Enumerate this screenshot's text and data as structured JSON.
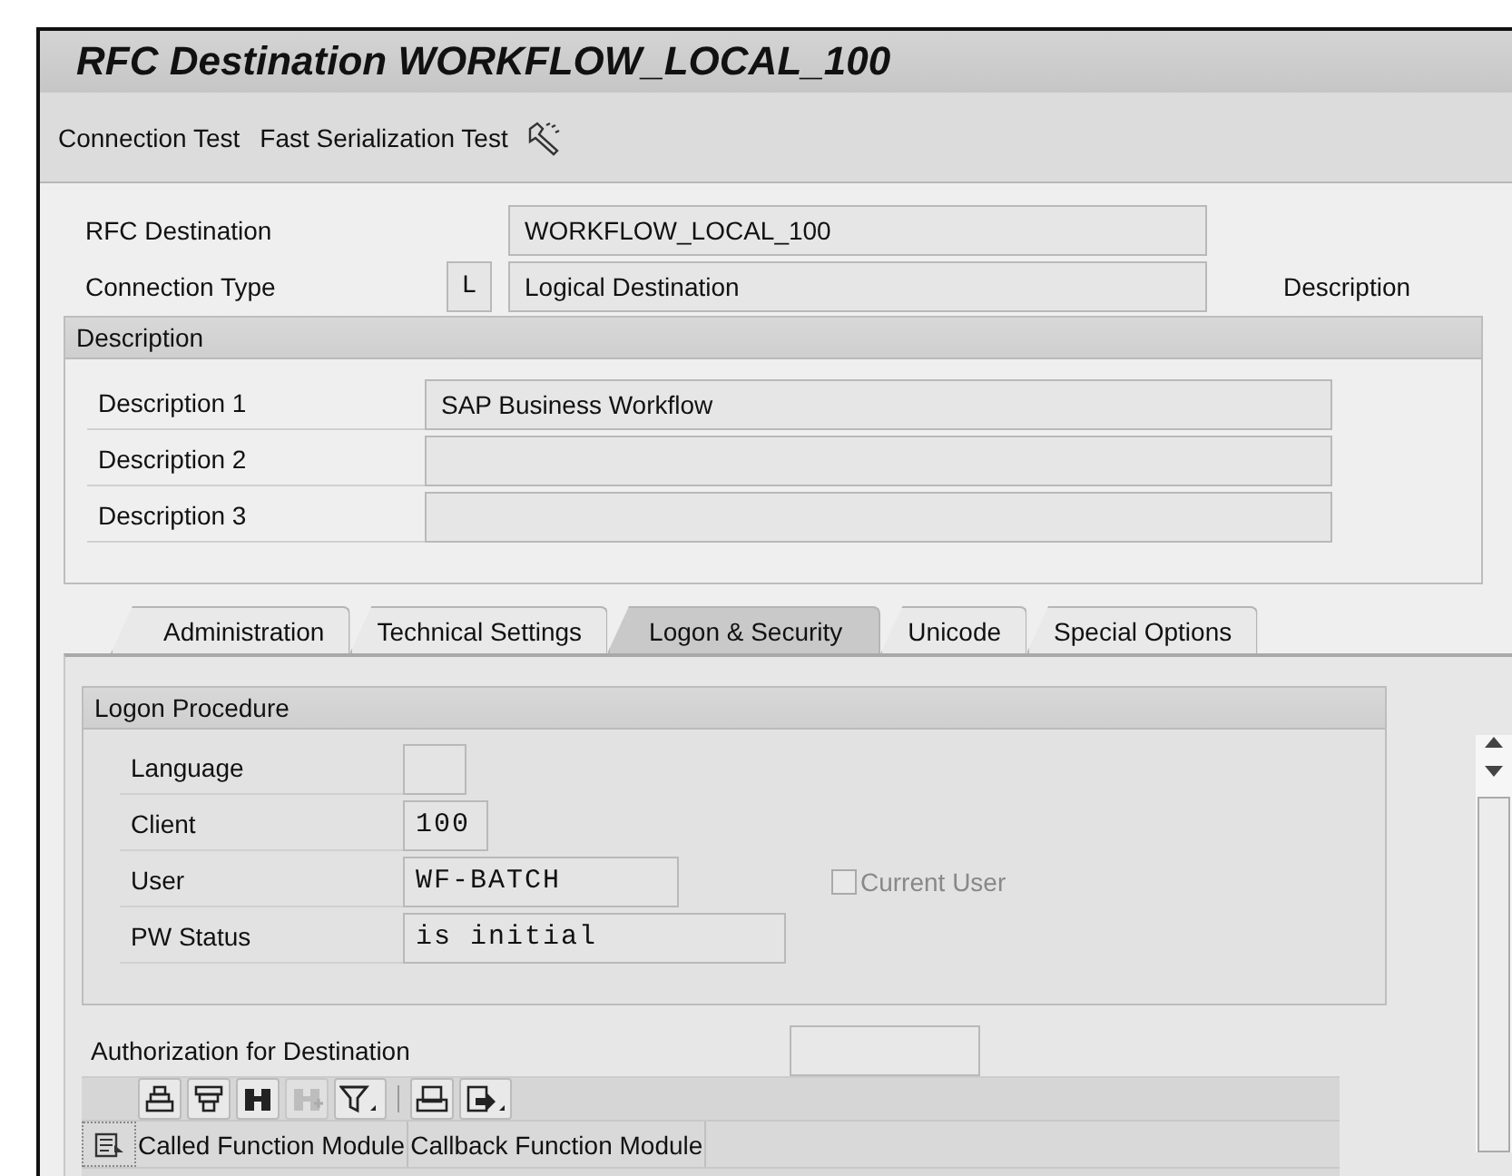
{
  "window": {
    "title": "RFC Destination WORKFLOW_LOCAL_100"
  },
  "toolbar": [
    {
      "kind": "text",
      "label": "Connection Test"
    },
    {
      "kind": "text",
      "label": "Fast Serialization Test"
    },
    {
      "kind": "icon"
    }
  ],
  "header_fields": [
    {
      "label": "RFC Destination",
      "value": "WORKFLOW_LOCAL_100"
    },
    {
      "label": "Connection Type",
      "code": "L",
      "value": "Logical Destination",
      "note": "Description"
    }
  ],
  "description_group": {
    "title": "Description",
    "rows": [
      {
        "label": "Description 1",
        "value": "SAP Business Workflow"
      },
      {
        "label": "Description 2"
      },
      {
        "label": "Description 3"
      }
    ]
  },
  "tabs": [
    {
      "label": "Administration",
      "selected": false
    },
    {
      "label": "Technical Settings",
      "selected": false
    },
    {
      "label": "Logon & Security",
      "selected": true
    },
    {
      "label": "Unicode",
      "selected": false
    },
    {
      "label": "Special Options",
      "selected": false
    }
  ],
  "logon_group": {
    "title": "Logon Procedure",
    "rows": [
      {
        "label": "Language"
      },
      {
        "label": "Client",
        "value": "100"
      },
      {
        "label": "User",
        "value": "WF-BATCH",
        "checkbox": {
          "label": "Current User",
          "checked": false,
          "disabled": true
        }
      },
      {
        "label": "PW Status",
        "value": "is initial"
      }
    ]
  },
  "authorization": {
    "label": "Authorization for Destination"
  },
  "alv_toolbar": [
    {
      "kind": "sort-up",
      "disabled": false
    },
    {
      "kind": "sort-down",
      "disabled": false
    },
    {
      "kind": "find",
      "disabled": false
    },
    {
      "kind": "find-next",
      "disabled": true
    },
    {
      "kind": "filter",
      "disabled": false
    },
    {
      "kind": "separator"
    },
    {
      "kind": "print",
      "disabled": false
    },
    {
      "kind": "export",
      "disabled": false
    }
  ],
  "table": {
    "columns": [
      "Called Function Module",
      "Callback Function Module"
    ]
  }
}
